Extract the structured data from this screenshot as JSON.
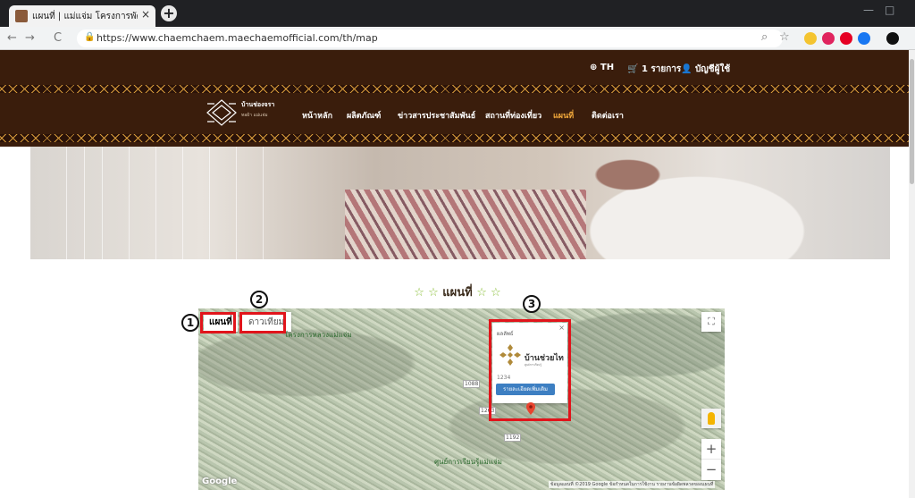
{
  "browser": {
    "tab_title": "แผนที่ | แม่แจ่ม โครงการพัฒนาอนุรักษ์ผ้า",
    "tab_close": "×",
    "new_tab": "+",
    "url": "https://www.chaemchaem.maechaemofficial.com/th/map",
    "nav_back": "←",
    "nav_forward": "→",
    "nav_reload": "C",
    "lock_icon": "🔒",
    "zoom_icon": "⌕",
    "bookmark_icon": "☆",
    "window_min": "—",
    "window_max": "□",
    "extension_colors": [
      "#f4c430",
      "#e0245e",
      "#e60023",
      "#1877f2",
      "#111111"
    ]
  },
  "site": {
    "language": "TH",
    "cart": "1 รายการ",
    "account": "บัญชีผู้ใช้",
    "logo": {
      "name": "บ้านช่องจรา",
      "sub": "ทอผ้า แม่แจ่ม"
    },
    "nav": [
      {
        "label": "หน้าหลัก",
        "active": false
      },
      {
        "label": "ผลิตภัณฑ์",
        "active": false
      },
      {
        "label": "ข่าวสารประชาสัมพันธ์",
        "active": false
      },
      {
        "label": "สถานที่ท่องเที่ยว",
        "active": false
      },
      {
        "label": "แผนที่",
        "active": true
      },
      {
        "label": "ติดต่อเรา",
        "active": false
      }
    ],
    "colors": {
      "header_bg": "#3a1d0c",
      "accent": "#f2a93b",
      "pattern": "#d69a3a",
      "annotation": "#e1141b"
    }
  },
  "page": {
    "heading_star_left": "☆ ☆",
    "heading": "แผนที่",
    "heading_star_right": "☆ ☆"
  },
  "map": {
    "type_map": "แผนที่",
    "type_satellite": "ดาวเทียม",
    "fullscreen": "⛶",
    "zoom_in": "+",
    "zoom_out": "−",
    "place_top": "โครงการหลวงแม่แจ่ม",
    "place_bottom": "ศูนย์การเรียนรู้แม่แจ่ม",
    "road_a": "1088",
    "road_b": "1263",
    "road_c": "1192",
    "google": "Google",
    "attribution": "ข้อมูลแผนที่ ©2019 Google   ข้อกำหนดในการใช้งาน   รายงานข้อผิดพลาดของแผนที่",
    "info_window": {
      "type": "ผลลัพธ์",
      "close": "×",
      "brand": "บ้านช่วยไท",
      "brand_sub": "ศูนย์การเรียนรู้",
      "code": "1234",
      "button": "รายละเอียดเพิ่มเติม"
    }
  },
  "annotations": [
    "1",
    "2",
    "3"
  ]
}
